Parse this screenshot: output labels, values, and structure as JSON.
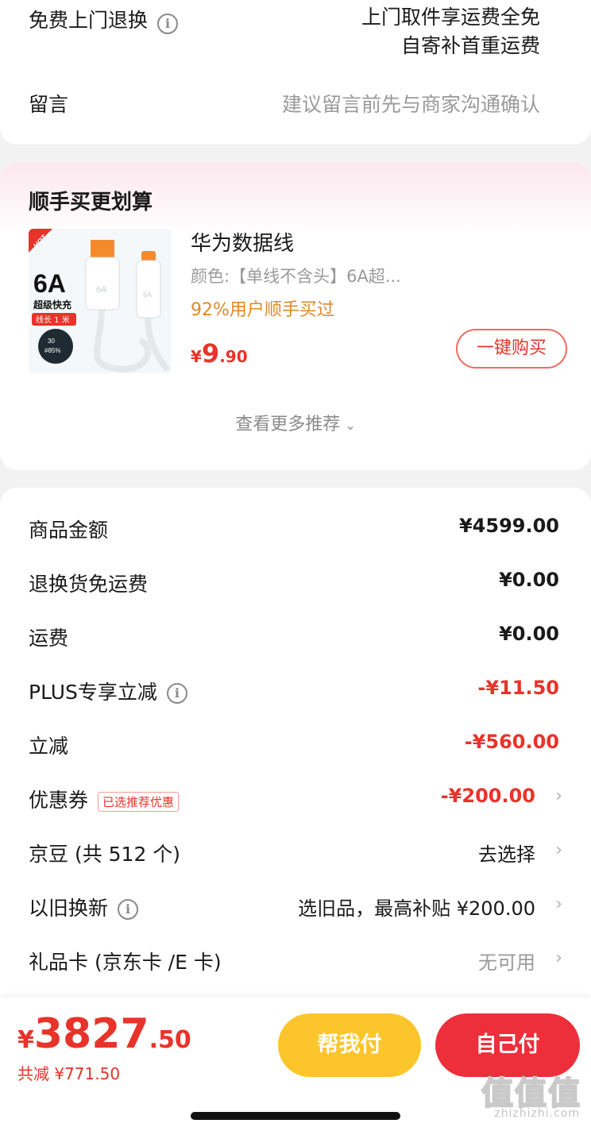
{
  "return_service": {
    "label": "免费上门退换",
    "value_line1": "上门取件享运费全免",
    "value_line2": "自寄补首重运费"
  },
  "message": {
    "label": "留言",
    "placeholder": "建议留言前先与商家沟通确认"
  },
  "recommend": {
    "title": "顺手买更划算",
    "product": {
      "image_text": {
        "badge": "HOT",
        "big": "6A",
        "sub": "超级快充",
        "length": "线长 1 米",
        "circle_line1": "30",
        "circle_line2": "#85%",
        "plug_left": "6A",
        "plug_right": "6A"
      },
      "name": "华为数据线",
      "spec": "颜色:【单线不含头】6A超...",
      "tag": "92%用户顺手买过",
      "price_symbol": "¥",
      "price_int": "9",
      "price_dec": ".90",
      "buy_label": "一键购买"
    },
    "more_label": "查看更多推荐"
  },
  "fees": [
    {
      "label": "商品金额",
      "value": "¥4599.00",
      "style": "bold",
      "arrow": false,
      "info": false,
      "badge": ""
    },
    {
      "label": "退换货免运费",
      "value": "¥0.00",
      "style": "bold",
      "arrow": false,
      "info": false,
      "badge": ""
    },
    {
      "label": "运费",
      "value": "¥0.00",
      "style": "bold",
      "arrow": false,
      "info": false,
      "badge": ""
    },
    {
      "label": "PLUS专享立减",
      "value": "-¥11.50",
      "style": "red",
      "arrow": false,
      "info": true,
      "badge": ""
    },
    {
      "label": "立减",
      "value": "-¥560.00",
      "style": "red",
      "arrow": false,
      "info": false,
      "badge": ""
    },
    {
      "label": "优惠券",
      "value": "-¥200.00",
      "style": "red",
      "arrow": true,
      "info": false,
      "badge": "已选推荐优惠"
    },
    {
      "label": "京豆 (共 512 个)",
      "value": "去选择",
      "style": "plain",
      "arrow": true,
      "info": false,
      "badge": ""
    },
    {
      "label": "以旧换新",
      "value": "选旧品，最高补贴 ¥200.00",
      "style": "plain",
      "arrow": true,
      "info": true,
      "badge": ""
    },
    {
      "label": "礼品卡 (京东卡 /E 卡)",
      "value": "无可用",
      "style": "gray",
      "arrow": true,
      "info": false,
      "badge": ""
    }
  ],
  "footer": {
    "total_symbol": "¥",
    "total_int": "3827",
    "total_dec": ".50",
    "saved": "共减 ¥771.50",
    "help_pay": "帮我付",
    "self_pay": "自己付",
    "watermark_logo": "值值值",
    "watermark": "zhizhizhi.com"
  },
  "colors": {
    "accent_red": "#e8332a",
    "help_yellow": "#fcc52b",
    "pay_red": "#ec2f3b",
    "tag_orange": "#e0892a"
  }
}
